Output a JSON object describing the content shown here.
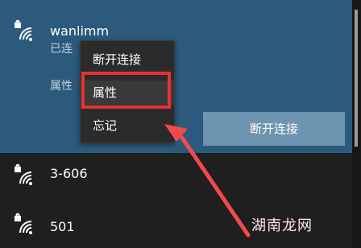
{
  "networks": [
    {
      "name": "wanlimm",
      "status": "已连",
      "properties_label": "属性",
      "secured": true,
      "selected": true
    },
    {
      "name": "3-606",
      "secured": true
    },
    {
      "name": "501",
      "secured": true
    }
  ],
  "actions": {
    "disconnect_label": "断开连接"
  },
  "context_menu": {
    "items": [
      "断开连接",
      "属性",
      "忘记"
    ],
    "highlighted_index": 1
  },
  "annotation": {
    "highlight_color": "#e53334",
    "arrow_color": "#f24a4a"
  },
  "watermark": {
    "text": "湖南龙网"
  },
  "colors": {
    "selected_background": "#2b5a7d",
    "button_background": "#6d94b0",
    "list_background": "#1f1f1f"
  }
}
